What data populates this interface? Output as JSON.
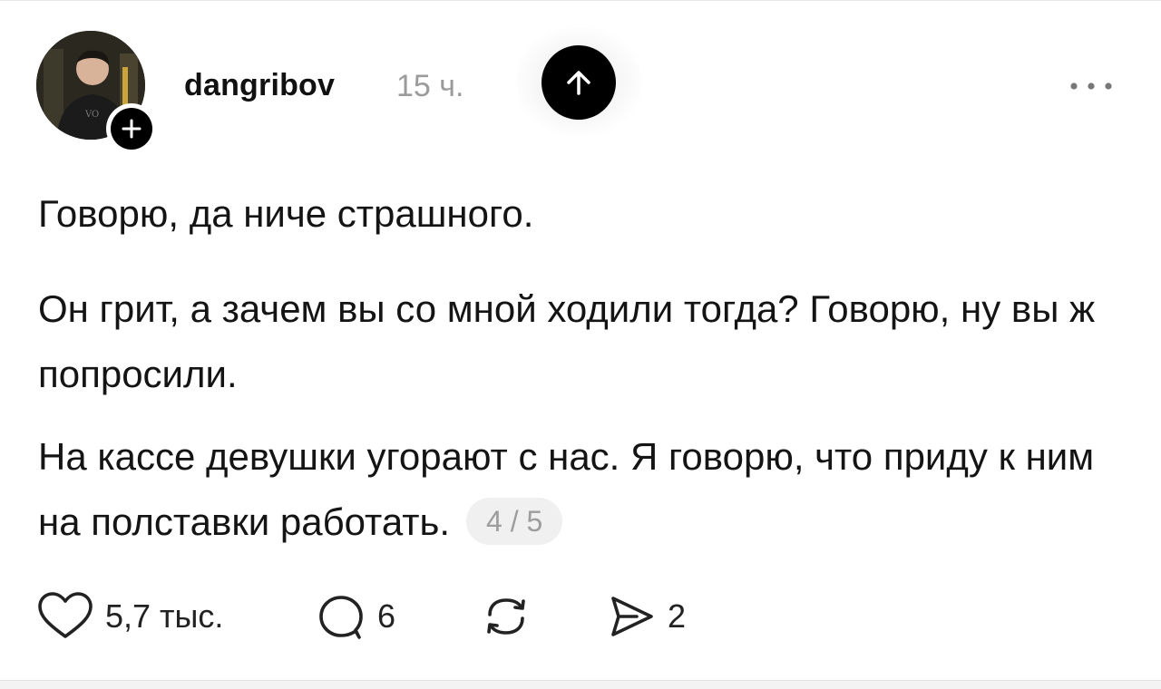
{
  "post": {
    "author": "dangribov",
    "time": "15 ч.",
    "paragraphs": [
      "Говорю, да ниче страшного.",
      "Он грит, а зачем вы со мной ходили тогда? Говорю, ну вы ж попросили.",
      "На кассе девушки угорают с нас. Я говорю, что приду к ним на полставки работать."
    ],
    "counter": "4 / 5"
  },
  "actions": {
    "likes": "5,7 тыс.",
    "replies": "6",
    "reposts": "",
    "shares": "2"
  },
  "icons": {
    "follow": "plus-icon",
    "scroll_up": "arrow-up-icon",
    "more": "more-dots-icon",
    "like": "heart-icon",
    "reply": "comment-bubble-icon",
    "repost": "repost-arrows-icon",
    "share": "send-icon"
  },
  "colors": {
    "text": "#111111",
    "muted": "#9b9b9b",
    "counter_bg": "#f0f0f0",
    "button": "#000000"
  }
}
